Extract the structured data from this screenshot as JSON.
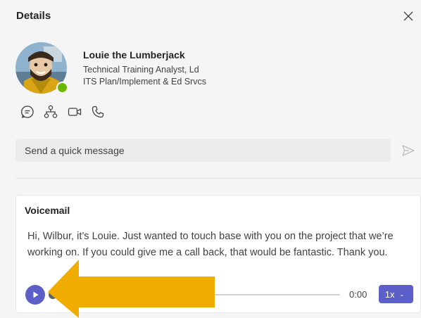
{
  "header": {
    "title": "Details"
  },
  "profile": {
    "name": "Louie the Lumberjack",
    "title": "Technical Training Analyst, Ld",
    "department": "ITS Plan/Implement & Ed Srvcs",
    "presence": "available",
    "presence_color": "#6bb700"
  },
  "actions": [
    {
      "icon": "chat-icon"
    },
    {
      "icon": "org-chart-icon"
    },
    {
      "icon": "video-call-icon"
    },
    {
      "icon": "phone-icon"
    }
  ],
  "quick_message": {
    "placeholder": "Send a quick message",
    "send_icon": "send-icon"
  },
  "voicemail": {
    "title": "Voicemail",
    "transcript": "Hi, Wilbur, it’s Louie. Just wanted to touch base with you on the project that we’re working on. If you could give me a call back, that would be fantastic. Thank you.",
    "elapsed": "0:00",
    "progress": 0,
    "speed": "1x",
    "accent_color": "#5b5fc7"
  },
  "annotation": {
    "arrow_color": "#f0ac00"
  }
}
